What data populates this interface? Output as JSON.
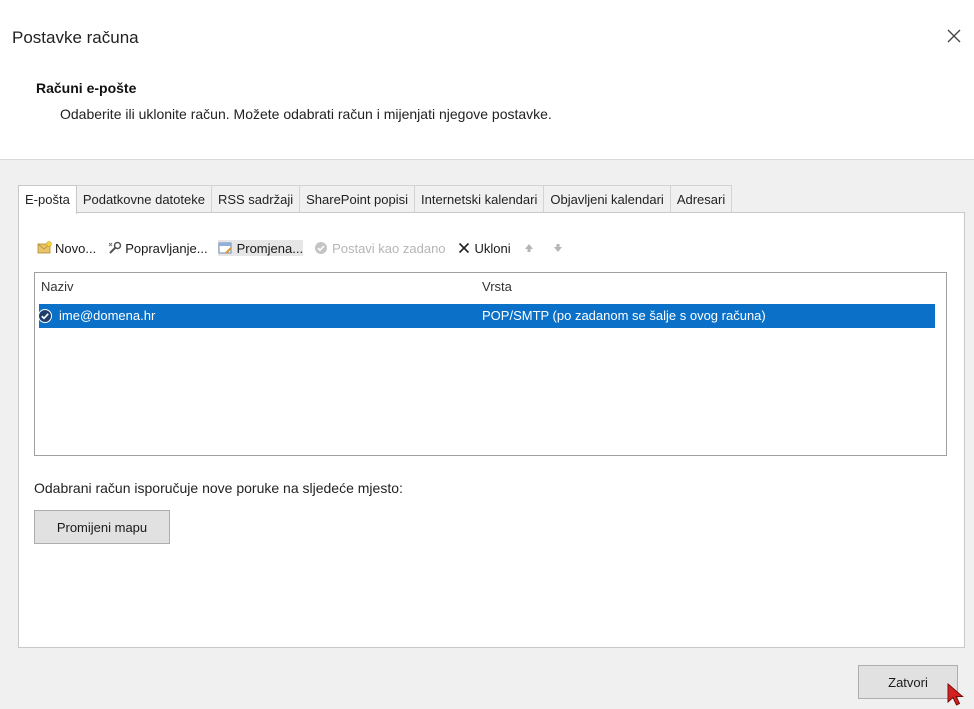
{
  "window": {
    "title": "Postavke računa"
  },
  "header": {
    "heading": "Računi e-pošte",
    "description": "Odaberite ili uklonite račun. Možete odabrati račun i mijenjati njegove postavke."
  },
  "tabs": [
    {
      "label": "E-pošta",
      "active": true
    },
    {
      "label": "Podatkovne datoteke"
    },
    {
      "label": "RSS sadržaji"
    },
    {
      "label": "SharePoint popisi"
    },
    {
      "label": "Internetski kalendari"
    },
    {
      "label": "Objavljeni kalendari"
    },
    {
      "label": "Adresari"
    }
  ],
  "toolbar": {
    "new_label": "Novo...",
    "repair_label": "Popravljanje...",
    "change_label": "Promjena...",
    "set_default_label": "Postavi kao zadano",
    "remove_label": "Ukloni"
  },
  "accounts_list": {
    "columns": [
      "Naziv",
      "Vrsta"
    ],
    "rows": [
      {
        "name": "ime@domena.hr",
        "type": "POP/SMTP (po zadanom se šalje s ovog računa)",
        "selected": true
      }
    ]
  },
  "delivery": {
    "text": "Odabrani račun isporučuje nove poruke na sljedeće mjesto:",
    "change_folder_label": "Promijeni mapu"
  },
  "footer": {
    "close_label": "Zatvori"
  },
  "colors": {
    "selection": "#0a70c8",
    "disabled_text": "#b5b5b5",
    "content_bg": "#f0f0f0"
  }
}
